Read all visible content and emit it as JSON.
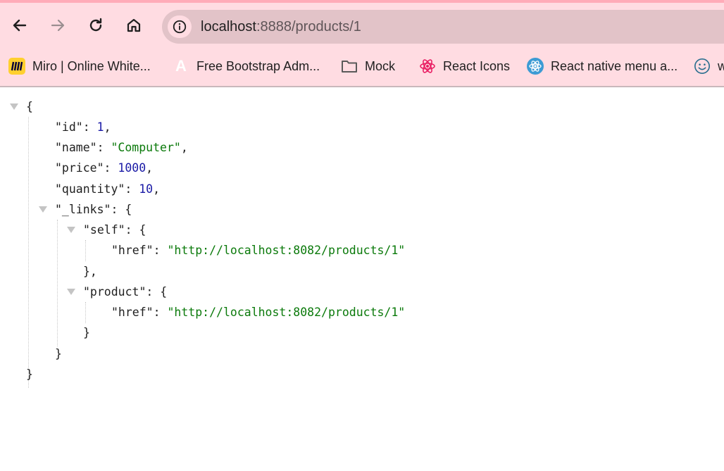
{
  "browser": {
    "url_host": "localhost",
    "url_rest": ":8888/products/1",
    "nav": {
      "back": "back-arrow-icon",
      "forward": "forward-arrow-icon",
      "reload": "reload-icon",
      "home": "home-icon",
      "site_info": "info-icon"
    },
    "bookmarks": [
      {
        "label": "Miro | Online White...",
        "icon": "miro-icon"
      },
      {
        "label": "Free Bootstrap Adm...",
        "icon": "admin-template-icon"
      },
      {
        "label": "Mock",
        "icon": "folder-icon"
      },
      {
        "label": "React Icons",
        "icon": "react-pink-icon"
      },
      {
        "label": "React native menu a...",
        "icon": "react-blue-icon"
      },
      {
        "label": "w",
        "icon": "smiley-icon"
      }
    ],
    "colors": {
      "toolbar_bg": "#ffdce2",
      "omnibox_bg": "#e2c3c8",
      "top_strip": "#ffabb8"
    }
  },
  "json_view": {
    "open_brace": "{",
    "close_brace": "}",
    "fields": [
      {
        "key": "\"id\"",
        "value": "1",
        "type": "number"
      },
      {
        "key": "\"name\"",
        "value": "\"Computer\"",
        "type": "string"
      },
      {
        "key": "\"price\"",
        "value": "1000",
        "type": "number"
      },
      {
        "key": "\"quantity\"",
        "value": "10",
        "type": "number"
      }
    ],
    "links": {
      "key": "\"_links\"",
      "self": {
        "key": "\"self\"",
        "href_key": "\"href\"",
        "href": "\"http://localhost:8082/products/1\""
      },
      "product": {
        "key": "\"product\"",
        "href_key": "\"href\"",
        "href": "\"http://localhost:8082/products/1\""
      }
    },
    "colors": {
      "string": "#0b7a0b",
      "number": "#1a1aa6",
      "key": "#1f1f1f"
    }
  },
  "punct": {
    "colon": ": ",
    "comma": ",",
    "obj_open": "{",
    "obj_close": "}",
    "obj_close_comma": "},"
  }
}
